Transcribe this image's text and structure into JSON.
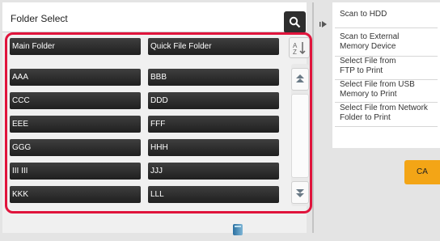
{
  "header": {
    "title": "Folder Select"
  },
  "columns": [
    "Main Folder",
    "Quick File Folder"
  ],
  "folders": [
    [
      "AAA",
      "BBB"
    ],
    [
      "CCC",
      "DDD"
    ],
    [
      "EEE",
      "FFF"
    ],
    [
      "GGG",
      "HHH"
    ],
    [
      "III III",
      "JJJ"
    ],
    [
      "KKK",
      "LLL"
    ]
  ],
  "menu": [
    "Scan to HDD",
    "Scan to External Memory Device",
    "Select File from FTP to Print",
    "Select File from USB Memory to Print",
    "Select File from Network Folder to Print"
  ],
  "ca_label": "CA",
  "colors": {
    "accent": "#e0143c",
    "ca": "#f3a516",
    "cell": "#2a2a2a",
    "scroll_arrow": "#6a7a86"
  },
  "icons": [
    "search-icon",
    "sort-icon",
    "scroll-up-icon",
    "scroll-down-icon",
    "collapse-arrow-icon",
    "storage-icon"
  ]
}
